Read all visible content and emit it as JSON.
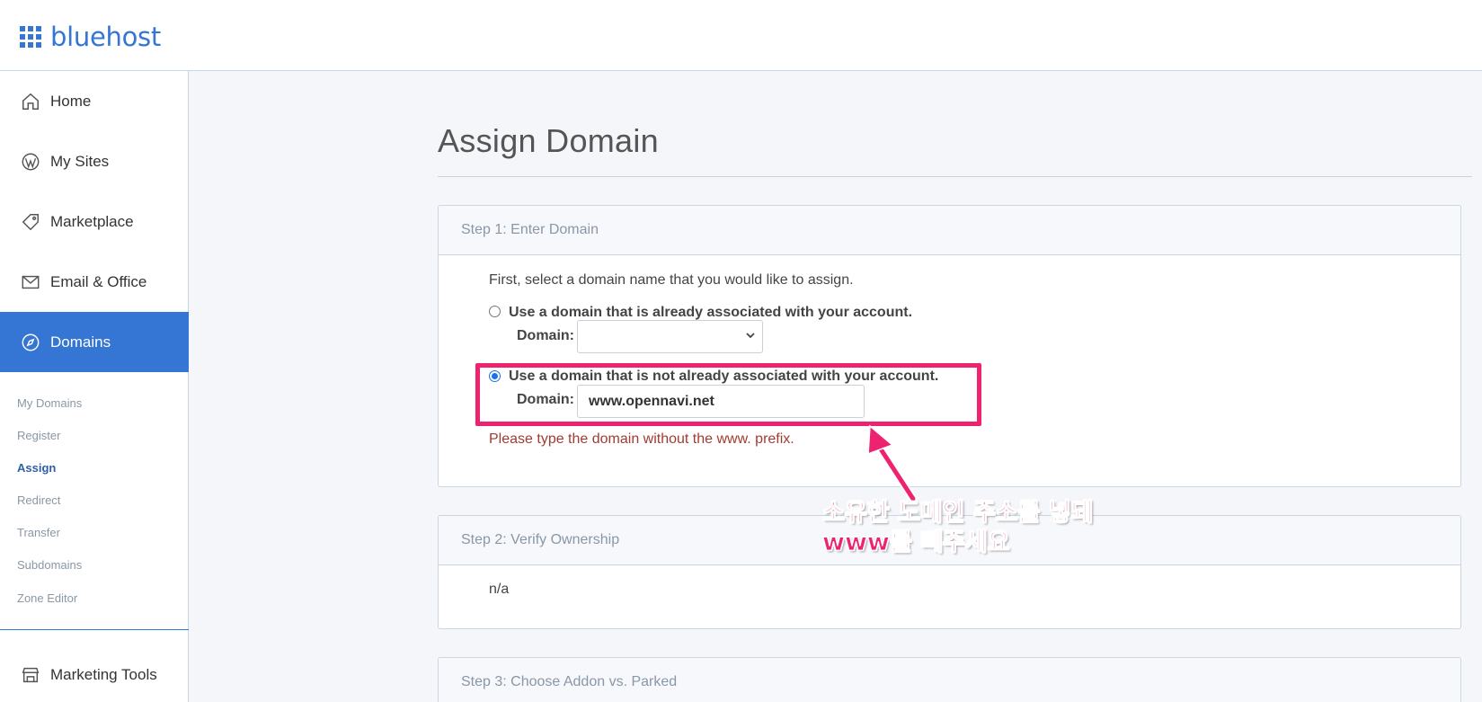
{
  "brand": {
    "name": "bluehost"
  },
  "sidebar": {
    "items": [
      {
        "label": "Home",
        "icon": "home-icon"
      },
      {
        "label": "My Sites",
        "icon": "wordpress-icon"
      },
      {
        "label": "Marketplace",
        "icon": "tag-icon"
      },
      {
        "label": "Email & Office",
        "icon": "mail-icon"
      },
      {
        "label": "Domains",
        "icon": "compass-icon",
        "active": true
      }
    ],
    "subitems": [
      "My Domains",
      "Register",
      "Assign",
      "Redirect",
      "Transfer",
      "Subdomains",
      "Zone Editor"
    ],
    "current_subitem": "Assign",
    "bottom_item": {
      "label": "Marketing Tools",
      "icon": "store-icon"
    }
  },
  "page": {
    "title": "Assign Domain"
  },
  "step1": {
    "header": "Step 1: Enter Domain",
    "intro": "First, select a domain name that you would like to assign.",
    "option_existing": "Use a domain that is already associated with your account.",
    "option_new": "Use a domain that is not already associated with your account.",
    "domain_label": "Domain:",
    "select_value": "",
    "input_value": "www.opennavi.net",
    "selected_option": "option_new",
    "error": "Please type the domain without the www. prefix."
  },
  "step2": {
    "header": "Step 2: Verify Ownership",
    "body": "n/a"
  },
  "step3": {
    "header": "Step 3: Choose Addon vs. Parked"
  },
  "annotation": {
    "line1": "소유한 도메인 주소를 넣돼",
    "line2": "www를 빼주세요",
    "color": "#ee2370"
  },
  "colors": {
    "accent": "#3575d3",
    "error": "#a33b30",
    "highlight": "#ee2370"
  }
}
